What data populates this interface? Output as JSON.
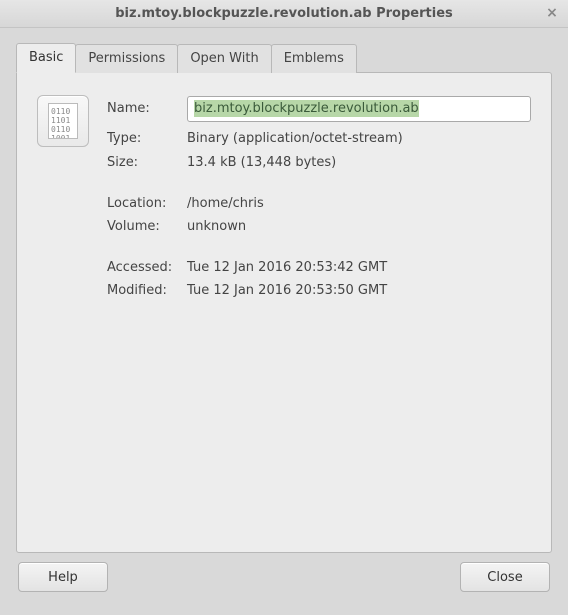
{
  "window": {
    "title": "biz.mtoy.blockpuzzle.revolution.ab Properties"
  },
  "tabs": [
    {
      "label": "Basic"
    },
    {
      "label": "Permissions"
    },
    {
      "label": "Open With"
    },
    {
      "label": "Emblems"
    }
  ],
  "active_tab_index": 0,
  "file_icon": {
    "glyph": "0110\n1101\n0110\n1001"
  },
  "fields": {
    "name_label": "Name:",
    "name_value": "biz.mtoy.blockpuzzle.revolution.ab",
    "type_label": "Type:",
    "type_value": "Binary (application/octet-stream)",
    "size_label": "Size:",
    "size_value": "13.4 kB (13,448 bytes)",
    "location_label": "Location:",
    "location_value": "/home/chris",
    "volume_label": "Volume:",
    "volume_value": "unknown",
    "accessed_label": "Accessed:",
    "accessed_value": "Tue 12 Jan 2016 20:53:42 GMT",
    "modified_label": "Modified:",
    "modified_value": "Tue 12 Jan 2016 20:53:50 GMT"
  },
  "buttons": {
    "help": "Help",
    "close": "Close"
  }
}
